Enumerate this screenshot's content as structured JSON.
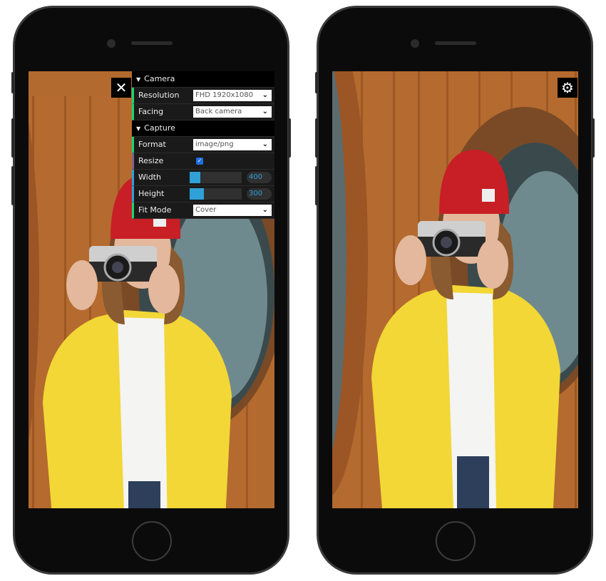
{
  "left_phone": {
    "close_icon": "close-icon",
    "gui": {
      "folders": [
        {
          "title": "Camera",
          "rows": [
            {
              "label": "Resolution",
              "type": "select",
              "value": "FHD 1920x1080"
            },
            {
              "label": "Facing",
              "type": "select",
              "value": "Back camera"
            }
          ]
        },
        {
          "title": "Capture",
          "rows": [
            {
              "label": "Format",
              "type": "select",
              "value": "image/png"
            },
            {
              "label": "Resize",
              "type": "checkbox",
              "checked": true
            },
            {
              "label": "Width",
              "type": "slider",
              "value": "400",
              "fill_fraction": 0.21
            },
            {
              "label": "Height",
              "type": "slider",
              "value": "300",
              "fill_fraction": 0.28
            },
            {
              "label": "Fit Mode",
              "type": "select",
              "value": "Cover"
            }
          ]
        }
      ]
    }
  },
  "right_phone": {
    "settings_icon": "gear-icon"
  },
  "colors": {
    "select_accent": "#1ed36f",
    "bool_accent": "#806787",
    "number_accent": "#2fa1d6"
  }
}
